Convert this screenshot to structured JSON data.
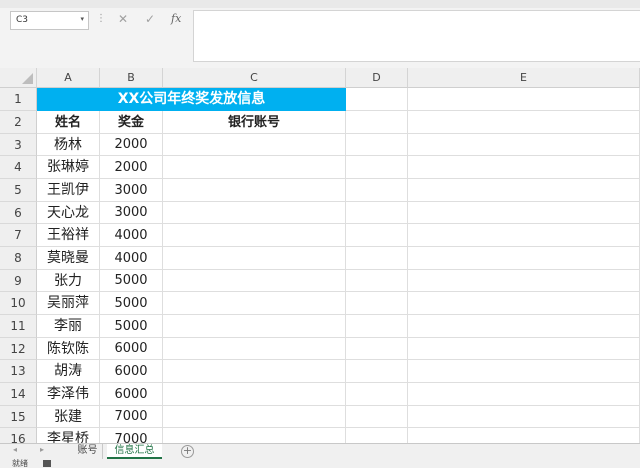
{
  "formula_bar": {
    "name_box": "C3",
    "dropdown_glyph": "▾",
    "separator": "⋮",
    "cancel_glyph": "✕",
    "enter_glyph": "✓",
    "fx_label": "fx",
    "formula": ""
  },
  "columns": [
    "A",
    "B",
    "C",
    "D",
    "E"
  ],
  "rows": [
    "1",
    "2",
    "3",
    "4",
    "5",
    "6",
    "7",
    "8",
    "9",
    "10",
    "11",
    "12",
    "13",
    "14",
    "15",
    "16"
  ],
  "sheet": {
    "title": "XX公司年终奖发放信息",
    "title_color": "#00b0f0",
    "headers": {
      "name": "姓名",
      "bonus": "奖金",
      "account": "银行账号"
    },
    "records": [
      {
        "name": "杨林",
        "bonus": "2000"
      },
      {
        "name": "张琳婷",
        "bonus": "2000"
      },
      {
        "name": "王凯伊",
        "bonus": "3000"
      },
      {
        "name": "天心龙",
        "bonus": "3000"
      },
      {
        "name": "王裕祥",
        "bonus": "4000"
      },
      {
        "name": "莫晓曼",
        "bonus": "4000"
      },
      {
        "name": "张力",
        "bonus": "5000"
      },
      {
        "name": "吴丽萍",
        "bonus": "5000"
      },
      {
        "name": "李丽",
        "bonus": "5000"
      },
      {
        "name": "陈钦陈",
        "bonus": "6000"
      },
      {
        "name": "胡涛",
        "bonus": "6000"
      },
      {
        "name": "李泽伟",
        "bonus": "6000"
      },
      {
        "name": "张建",
        "bonus": "7000"
      },
      {
        "name": "李星桥",
        "bonus": "7000"
      }
    ]
  },
  "tabs": {
    "prev_glyph": "◂",
    "next_glyph": "▸",
    "items": [
      "账号",
      "信息汇总"
    ],
    "active": "信息汇总",
    "add_glyph": "+"
  },
  "status": {
    "text": "就绪"
  }
}
